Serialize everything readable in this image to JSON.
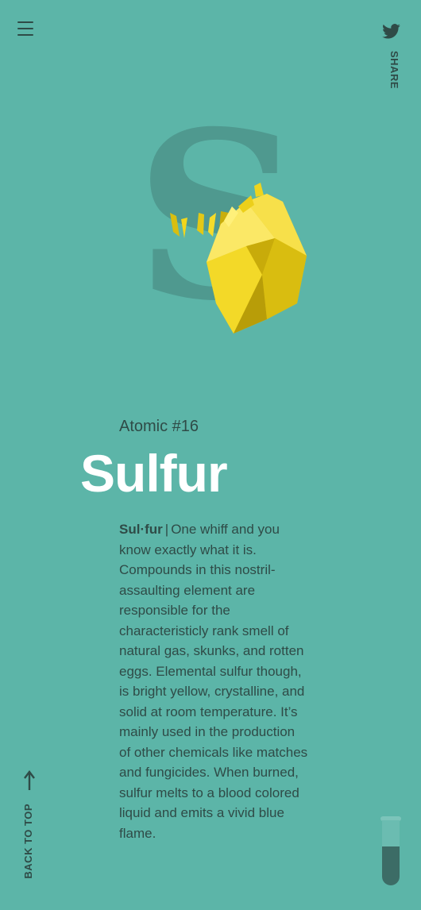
{
  "header": {
    "menu_icon": "hamburger-menu-icon",
    "share_icon": "twitter-icon",
    "share_label": "SHARE"
  },
  "hero": {
    "letter": "S",
    "image": "sulfur-crystal"
  },
  "element": {
    "atomic_label": "Atomic #16",
    "name": "Sulfur",
    "pronunciation": "Sul·fur",
    "separator": "|",
    "description": "One whiff and you know exactly what it is. Compounds in this nostril-assaulting element are responsible for the characteristicly rank smell of natural gas, skunks, and rotten eggs. Elemental sulfur though, is bright yellow, crystalline, and solid at room temperature. It’s mainly used in the production of other chemicals like matches and fungicides. When burned, sulfur melts to a blood colored liquid and emits a vivid blue flame."
  },
  "footer": {
    "back_to_top_label": "BACK TO TOP",
    "back_to_top_icon": "arrow-up-icon",
    "tube_icon": "test-tube-icon",
    "tube_fill_fraction": 0.6
  },
  "colors": {
    "background": "#5cb5a8",
    "text_dark": "#2f4b47",
    "title": "#ffffff",
    "crystal": "#f0d51a"
  }
}
